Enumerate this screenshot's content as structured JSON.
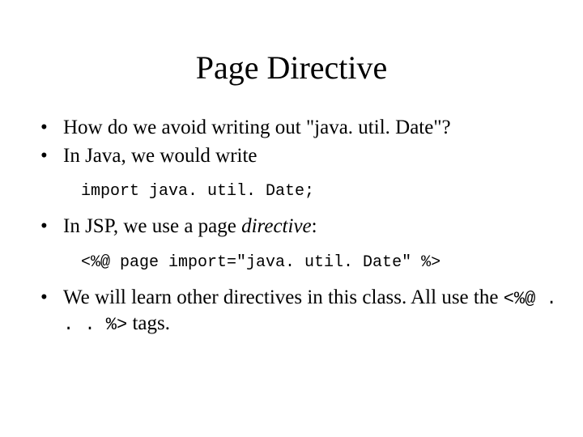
{
  "title": "Page Directive",
  "bullets": {
    "b1": "How do we avoid writing out \"java. util. Date\"?",
    "b2": "In Java, we would write",
    "code1": "import java. util. Date;",
    "b3_pre": "In JSP, we use a page ",
    "b3_em": "directive",
    "b3_post": ":",
    "code2": "<%@ page import=\"java. util. Date\" %>",
    "b4_pre": "We will learn other directives in this class.  All use the ",
    "b4_mono": "<%@ . . . %>",
    "b4_post": " tags."
  }
}
